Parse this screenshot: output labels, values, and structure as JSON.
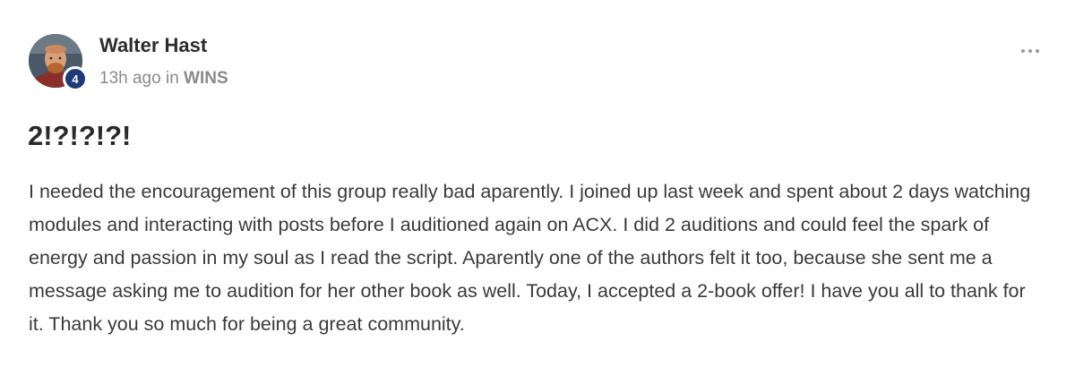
{
  "post": {
    "author": {
      "name": "Walter Hast",
      "level": "4"
    },
    "meta": {
      "time": "13h ago",
      "in_word": "in",
      "group": "WINS"
    },
    "title": "2!?!?!?!",
    "body": "I needed the encouragement of this group really bad aparently. I joined up last week and spent about 2 days watching modules and interacting with posts before I auditioned again on ACX. I did 2 auditions and could feel the spark of energy and passion in my soul as I read the script. Aparently one of the authors felt it too, because she sent me a message asking me to audition for her other book as well. Today, I accepted a 2-book offer! I have you all to thank for it. Thank you so much for being a great community.",
    "more_icon": "ellipsis-horizontal-icon"
  },
  "colors": {
    "badge": "#1f3a78",
    "meta_text": "#8a8a8a",
    "body_text": "#3a3a3a"
  }
}
